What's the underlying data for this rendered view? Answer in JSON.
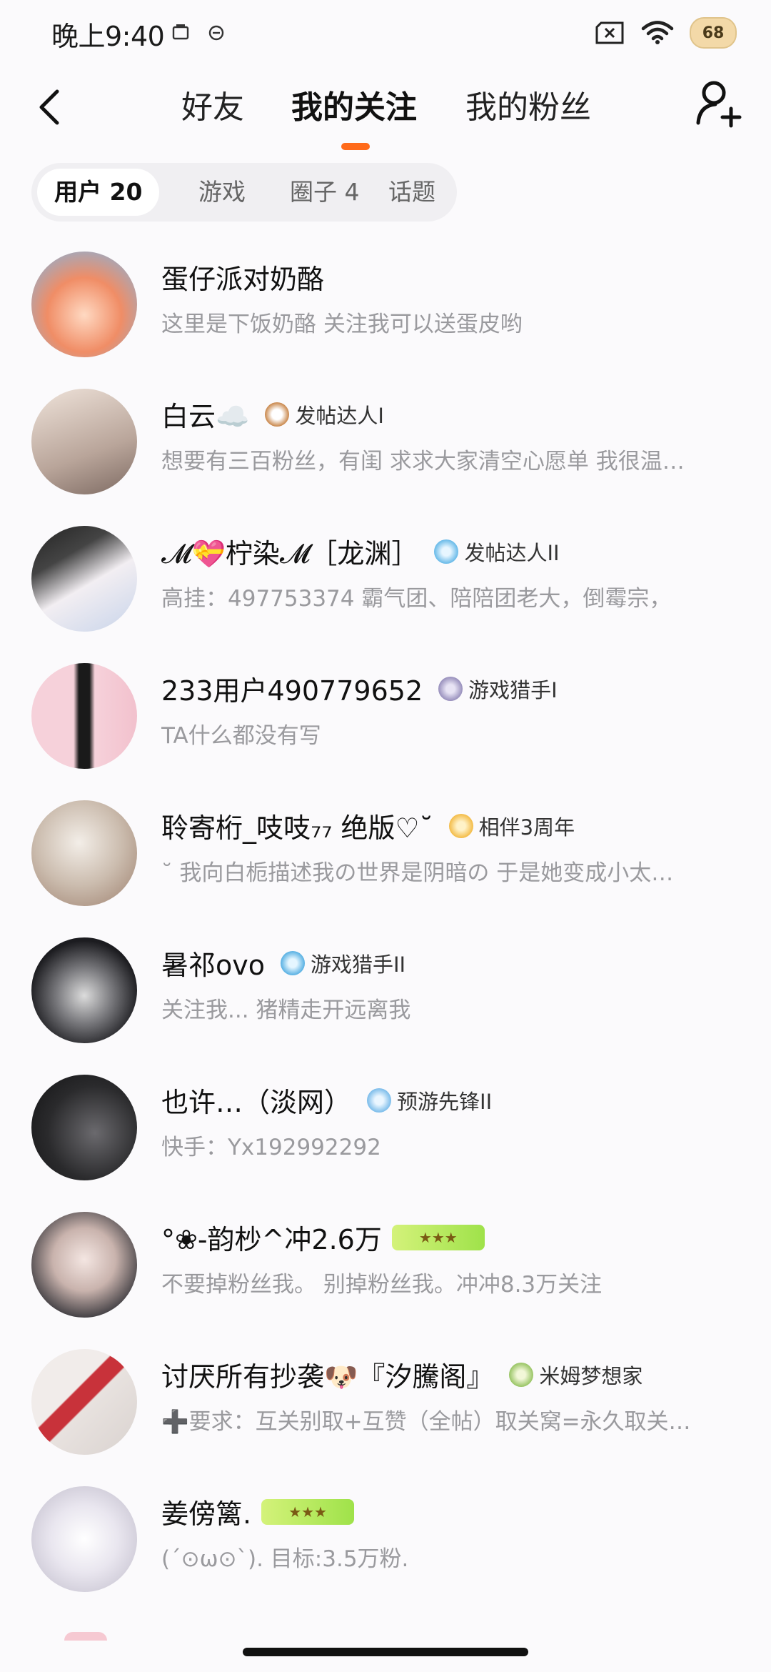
{
  "status": {
    "time": "晚上9:40",
    "battery": "68"
  },
  "header": {
    "tabs": [
      {
        "label": "好友"
      },
      {
        "label": "我的关注"
      },
      {
        "label": "我的粉丝"
      }
    ]
  },
  "filter": {
    "items": [
      {
        "label": "用户 20"
      },
      {
        "label": "游戏"
      },
      {
        "label": "圈子 4"
      },
      {
        "label": "话题"
      }
    ]
  },
  "users": [
    {
      "name": "蛋仔派对奶酪",
      "badge": "",
      "bio": "这里是下饭奶酪 关注我可以送蛋皮哟",
      "avatar_color": "#f4b07a"
    },
    {
      "name": "白云☁️",
      "badge": "发帖达人I",
      "bio": "想要有三百粉丝，有闺 求求大家清空心愿单 我很温…",
      "avatar_color": "#d9c8bd"
    },
    {
      "name": "𝓜💝柠染𝓜［龙渊］",
      "badge": "发帖达人II",
      "bio": "高挂：497753374 霸气团、陪陪团老大，倒霉宗，",
      "avatar_color": "#cfd6e6"
    },
    {
      "name": "233用户490779652",
      "badge": "游戏猎手I",
      "bio": "TA什么都没有写",
      "avatar_color": "#f2c6cf"
    },
    {
      "name": "聆寄桁_吱吱₇₇ 绝版♡˘",
      "badge": "相伴3周年",
      "bio": "˘ 我向白栀描述我の世界是阴暗の 于是她变成小太…",
      "avatar_color": "#cfc2b6"
    },
    {
      "name": "暑祁ovo",
      "badge": "游戏猎手II",
      "bio": "关注我... 猪精走开远离我",
      "avatar_color": "#3a3a3e"
    },
    {
      "name": "也许…（淡网）",
      "badge": "预游先锋II",
      "bio": "快手：Yx192992292",
      "avatar_color": "#2a2a2c"
    },
    {
      "name": "°❀-韵杪^冲2.6万",
      "badge": "",
      "bio": "不要掉粉丝我。 别掉粉丝我。冲冲8.3万关注",
      "avatar_color": "#c8ccd6"
    },
    {
      "name": "讨厌所有抄袭🐶『汐騰阁』",
      "badge": "米姆梦想家",
      "bio": "➕要求：互关别取+互赞（全帖）取关窝=永久取关…",
      "avatar_color": "#e9e3df"
    },
    {
      "name": "姜傍篱.",
      "badge": "",
      "bio": "(´⊙ω⊙`). 目标:3.5万粉.",
      "avatar_color": "#e7e4ee"
    }
  ]
}
